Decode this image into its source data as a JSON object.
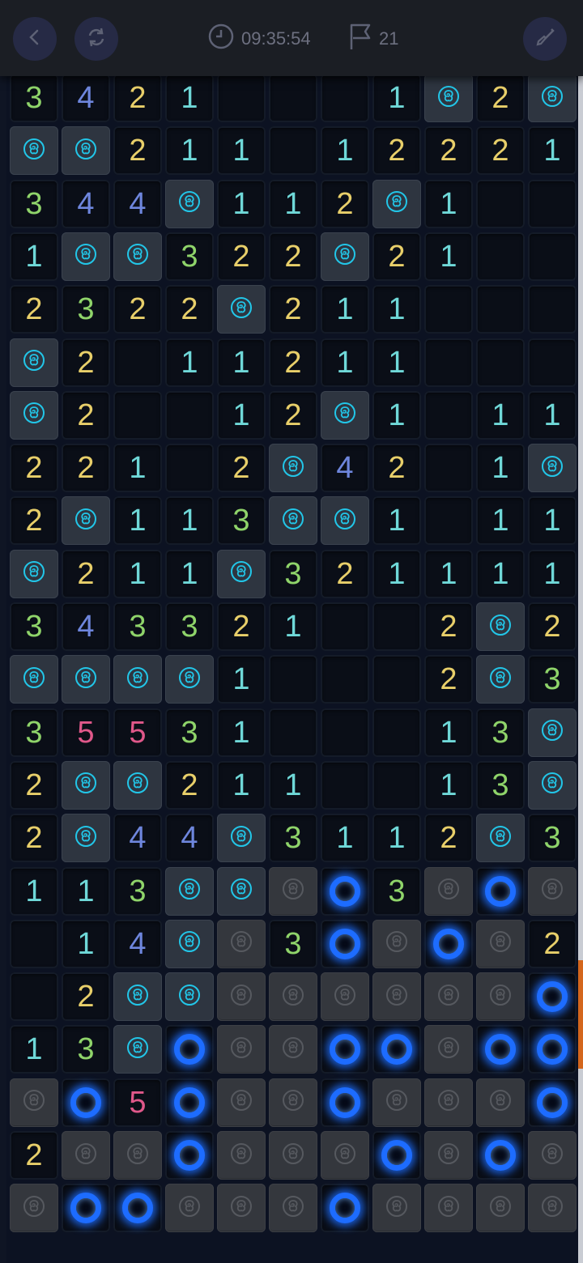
{
  "header": {
    "back_icon": "chevron-left-icon",
    "restart_icon": "refresh-icon",
    "timer_icon": "clock-icon",
    "timer_value": "09:35:54",
    "flag_icon": "flag-icon",
    "flag_count": "21",
    "tool_icon": "shovel-icon"
  },
  "colors": {
    "n1": "#6fd8d8",
    "n2": "#e8cf6a",
    "n3": "#8fd46a",
    "n4": "#6e86dd",
    "n5": "#e0588a",
    "flag_rose": "#22c6e8",
    "mine_ring": "#1d6cff",
    "scroll_thumb": "#d4661c"
  },
  "board": {
    "cols": 11,
    "legend": {
      "E": "empty revealed cell",
      "F": "flagged rose",
      "H": "unrevealed rose tile",
      "M": "mine",
      "1-5": "adjacent mine count"
    },
    "rows": [
      [
        "3",
        "4",
        "2",
        "1",
        "E",
        "E",
        "E",
        "1",
        "F",
        "2",
        "F"
      ],
      [
        "F",
        "F",
        "2",
        "1",
        "1",
        "E",
        "1",
        "2",
        "2",
        "2",
        "1"
      ],
      [
        "3",
        "4",
        "4",
        "F",
        "1",
        "1",
        "2",
        "F",
        "1",
        "E",
        "E"
      ],
      [
        "1",
        "F",
        "F",
        "3",
        "2",
        "2",
        "F",
        "2",
        "1",
        "E",
        "E"
      ],
      [
        "2",
        "3",
        "2",
        "2",
        "F",
        "2",
        "1",
        "1",
        "E",
        "E",
        "E"
      ],
      [
        "F",
        "2",
        "E",
        "1",
        "1",
        "2",
        "1",
        "1",
        "E",
        "E",
        "E"
      ],
      [
        "F",
        "2",
        "E",
        "E",
        "1",
        "2",
        "F",
        "1",
        "E",
        "1",
        "1"
      ],
      [
        "2",
        "2",
        "1",
        "E",
        "2",
        "F",
        "4",
        "2",
        "E",
        "1",
        "F"
      ],
      [
        "2",
        "F",
        "1",
        "1",
        "3",
        "F",
        "F",
        "1",
        "E",
        "1",
        "1"
      ],
      [
        "F",
        "2",
        "1",
        "1",
        "F",
        "3",
        "2",
        "1",
        "1",
        "1",
        "1"
      ],
      [
        "3",
        "4",
        "3",
        "3",
        "2",
        "1",
        "E",
        "E",
        "2",
        "F",
        "2"
      ],
      [
        "F",
        "F",
        "F",
        "F",
        "1",
        "E",
        "E",
        "E",
        "2",
        "F",
        "3"
      ],
      [
        "3",
        "5",
        "5",
        "3",
        "1",
        "E",
        "E",
        "E",
        "1",
        "3",
        "F"
      ],
      [
        "2",
        "F",
        "F",
        "2",
        "1",
        "1",
        "E",
        "E",
        "1",
        "3",
        "F"
      ],
      [
        "2",
        "F",
        "4",
        "4",
        "F",
        "3",
        "1",
        "1",
        "2",
        "F",
        "3"
      ],
      [
        "1",
        "1",
        "3",
        "F",
        "F",
        "H",
        "M",
        "3",
        "H",
        "M",
        "H"
      ],
      [
        "E",
        "1",
        "4",
        "F",
        "H",
        "3",
        "M",
        "H",
        "M",
        "H",
        "2"
      ],
      [
        "E",
        "2",
        "F",
        "F",
        "H",
        "H",
        "H",
        "H",
        "H",
        "H",
        "M"
      ],
      [
        "1",
        "3",
        "F",
        "M",
        "H",
        "H",
        "M",
        "M",
        "H",
        "M",
        "M"
      ],
      [
        "H",
        "M",
        "5",
        "M",
        "H",
        "H",
        "M",
        "H",
        "H",
        "H",
        "M"
      ],
      [
        "2",
        "H",
        "H",
        "M",
        "H",
        "H",
        "H",
        "M",
        "H",
        "M",
        "H"
      ],
      [
        "H",
        "M",
        "M",
        "H",
        "H",
        "H",
        "M",
        "H",
        "H",
        "H",
        "H"
      ]
    ]
  }
}
